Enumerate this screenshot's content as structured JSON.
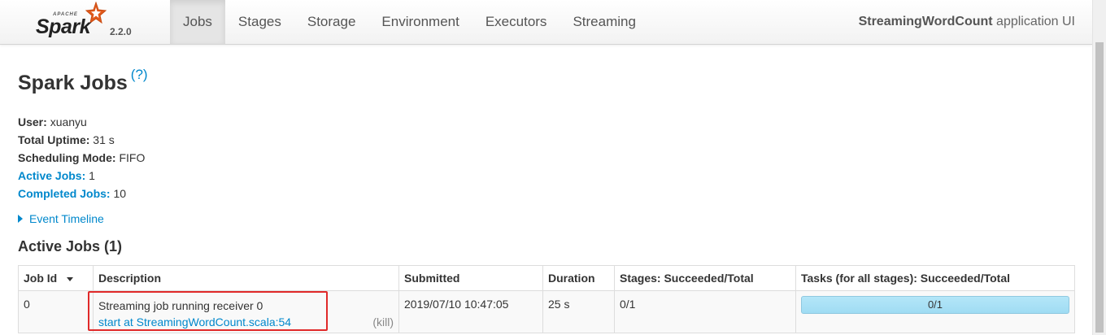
{
  "brand": {
    "apache": "APACHE",
    "name": "Spark",
    "version": "2.2.0"
  },
  "nav": {
    "tabs": [
      {
        "label": "Jobs",
        "active": true
      },
      {
        "label": "Stages",
        "active": false
      },
      {
        "label": "Storage",
        "active": false
      },
      {
        "label": "Environment",
        "active": false
      },
      {
        "label": "Executors",
        "active": false
      },
      {
        "label": "Streaming",
        "active": false
      }
    ],
    "app_name": "StreamingWordCount",
    "app_suffix": " application UI"
  },
  "page": {
    "title": "Spark Jobs",
    "help": "(?)",
    "user_label": "User:",
    "user": "xuanyu",
    "uptime_label": "Total Uptime:",
    "uptime": "31 s",
    "sched_label": "Scheduling Mode:",
    "sched": "FIFO",
    "active_label": "Active Jobs:",
    "active_count": "1",
    "completed_label": "Completed Jobs:",
    "completed_count": "10",
    "event_timeline": "Event Timeline",
    "section_title": "Active Jobs (1)"
  },
  "table": {
    "headers": [
      "Job Id",
      "Description",
      "Submitted",
      "Duration",
      "Stages: Succeeded/Total",
      "Tasks (for all stages): Succeeded/Total"
    ],
    "rows": [
      {
        "job_id": "0",
        "desc_name": "Streaming job running receiver 0",
        "desc_link": "start at StreamingWordCount.scala:54",
        "kill": "(kill)",
        "submitted": "2019/07/10 10:47:05",
        "duration": "25 s",
        "stages": "0/1",
        "tasks": "0/1",
        "task_progress": 0
      }
    ]
  },
  "colors": {
    "link": "#0088cc",
    "progress": "#9fdcf3",
    "highlight": "#e02a2a"
  }
}
